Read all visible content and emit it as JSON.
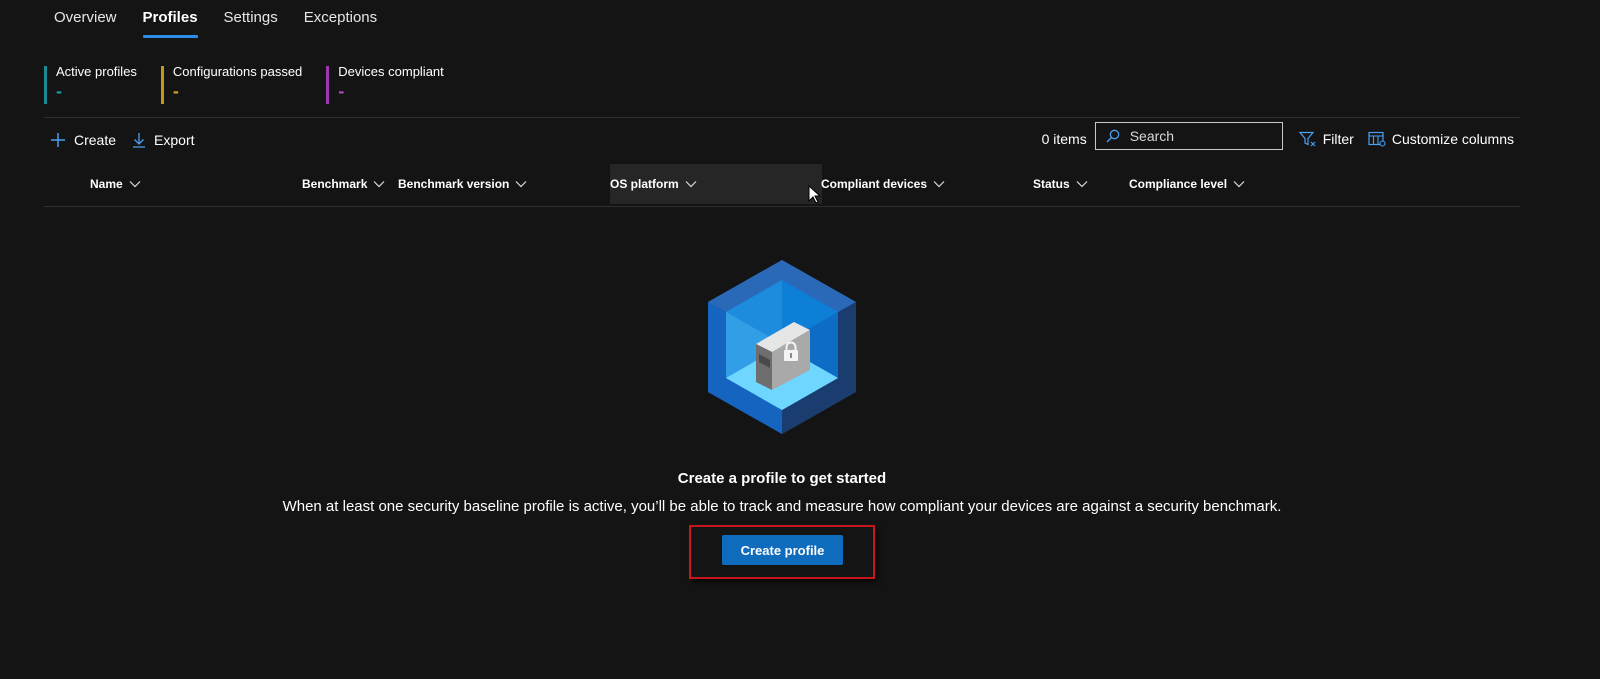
{
  "tabs": [
    {
      "label": "Overview",
      "active": false
    },
    {
      "label": "Profiles",
      "active": true
    },
    {
      "label": "Settings",
      "active": false
    },
    {
      "label": "Exceptions",
      "active": false
    }
  ],
  "metrics": [
    {
      "label": "Active profiles",
      "value": "-",
      "color": "#1b8a93"
    },
    {
      "label": "Configurations passed",
      "value": "-",
      "color": "#c49a14"
    },
    {
      "label": "Devices compliant",
      "value": "-",
      "color": "#9c37b0"
    }
  ],
  "toolbar": {
    "create_label": "Create",
    "export_label": "Export",
    "items_count": "0 items",
    "search_placeholder": "Search",
    "filter_label": "Filter",
    "customize_label": "Customize columns"
  },
  "columns": [
    {
      "label": "Name"
    },
    {
      "label": "Benchmark"
    },
    {
      "label": "Benchmark version"
    },
    {
      "label": "OS platform"
    },
    {
      "label": "Compliant devices"
    },
    {
      "label": "Status"
    },
    {
      "label": "Compliance level"
    }
  ],
  "empty_state": {
    "title": "Create a profile to get started",
    "description": "When at least one security baseline profile is active, you’ll be able to track and measure how compliant your devices are against a security benchmark.",
    "button_label": "Create profile"
  },
  "colors": {
    "accent": "#0f6cbd",
    "highlight": "#c8161d",
    "background": "#141414"
  }
}
